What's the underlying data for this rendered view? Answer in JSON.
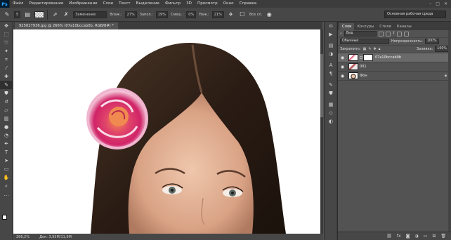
{
  "app": {
    "logo": "Ps"
  },
  "menu": [
    "Файл",
    "Редактирование",
    "Изображение",
    "Слои",
    "Текст",
    "Выделение",
    "Фильтр",
    "3D",
    "Просмотр",
    "Окно",
    "Справка"
  ],
  "window_controls": [
    "–",
    "□",
    "✕"
  ],
  "options": {
    "brush_size": "5",
    "mode_label": "Замена:",
    "mode_value": "Заменение",
    "flow_label": "Влаж.:",
    "flow_value": "27%",
    "strength_label": "Запол.:",
    "strength_value": "19%",
    "mix_label": "Смеш.:",
    "mix_value": "0%",
    "opacity2_label": "Наж.:",
    "opacity2_value": "21%",
    "all_layers": "Все сл.",
    "workspace": "Основная рабочая среда"
  },
  "document": {
    "tab": "925027936.jpg @ 266% (07a10bccab0b, RGB/8#) *",
    "zoom": "266,2%",
    "doc_info": "Док: 3,93M/11,9M"
  },
  "layers_panel": {
    "tabs": [
      "Слои",
      "Контуры",
      "Стили",
      "Каналы"
    ],
    "active_tab": 0,
    "filter_label": "Вид",
    "blend_mode": "Обычные",
    "opacity_label": "Непрозрачность:",
    "opacity_value": "100%",
    "lock_label": "Закрепить:",
    "fill_label": "Заливка:",
    "fill_value": "100%",
    "layers": [
      {
        "name": "07a10bccab0b",
        "selected": true,
        "has_mask": true
      },
      {
        "name": "001",
        "selected": false,
        "has_mask": false
      },
      {
        "name": "Фон",
        "selected": false,
        "has_mask": false,
        "locked": true
      }
    ],
    "footer_icons": [
      "link-icon",
      "fx-icon",
      "mask-icon",
      "adjustment-icon",
      "folder-icon",
      "new-layer-icon",
      "trash-icon"
    ]
  },
  "tools": [
    "move-icon",
    "marquee-icon",
    "lasso-icon",
    "quick-select-icon",
    "crop-icon",
    "eyedropper-icon",
    "healing-icon",
    "brush-icon",
    "stamp-icon",
    "history-brush-icon",
    "eraser-icon",
    "gradient-icon",
    "blur-icon",
    "dodge-icon",
    "pen-icon",
    "type-icon",
    "path-select-icon",
    "shape-icon",
    "hand-icon",
    "zoom-icon"
  ],
  "colors": {
    "foreground": "#ffffff",
    "background": "#ffffff",
    "menu_bg": "#3c3c3c",
    "panel_bg": "#535353"
  }
}
